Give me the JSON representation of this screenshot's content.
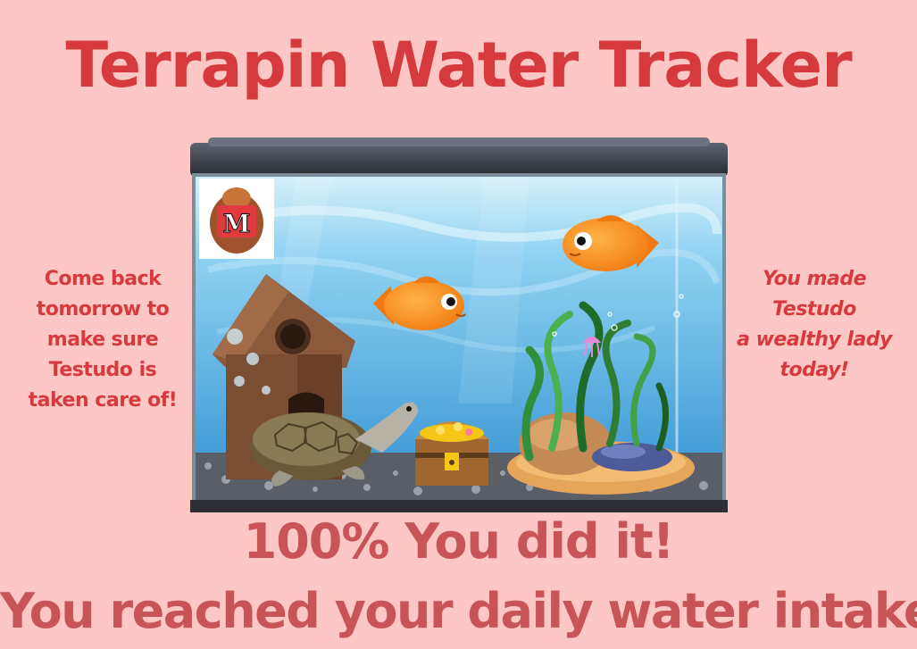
{
  "header": {
    "title": "Terrapin Water Tracker"
  },
  "left_note": {
    "lines": [
      "Come back",
      "tomorrow to",
      "make sure",
      "Testudo is",
      "taken care of!"
    ]
  },
  "right_note": {
    "lines": [
      "You made",
      "Testudo",
      "a wealthy lady",
      "today!"
    ]
  },
  "progress": {
    "percent_text": "100%",
    "status_text": "You did it!",
    "percent_value": 100
  },
  "message": {
    "text": "You reached your daily water intake!"
  },
  "logo": {
    "letter": "M"
  },
  "colors": {
    "background": "#fcc7c5",
    "title": "#d63a3f",
    "footer": "#c85458",
    "water": "#5cb8ea"
  }
}
